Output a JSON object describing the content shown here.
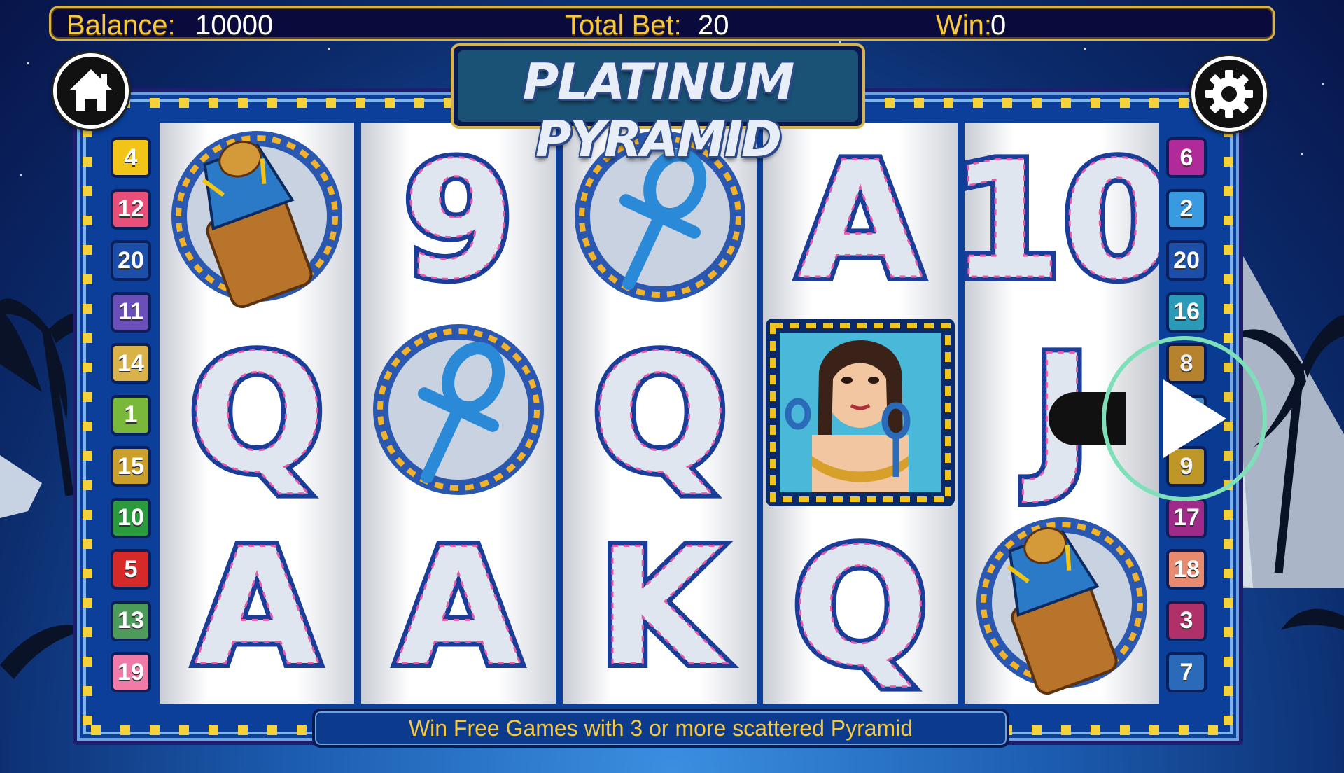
{
  "topbar": {
    "balance_label": "Balance:",
    "balance_value": "10000",
    "total_bet_label": "Total Bet:",
    "total_bet_value": "20",
    "win_label": "Win:",
    "win_value": "0"
  },
  "title": "PLATINUM PYRAMID",
  "info_message": "Win Free Games with 3 or more scattered Pyramid",
  "icons": {
    "home": "home-icon",
    "settings": "gear-icon",
    "spin": "play-icon"
  },
  "paylines_left": [
    {
      "n": "4",
      "color": "#f2c418"
    },
    {
      "n": "12",
      "color": "#e8507a"
    },
    {
      "n": "20",
      "color": "#1e4fa8"
    },
    {
      "n": "11",
      "color": "#6a4fb8"
    },
    {
      "n": "14",
      "color": "#d9b24a"
    },
    {
      "n": "1",
      "color": "#7ab83c"
    },
    {
      "n": "15",
      "color": "#caa02a"
    },
    {
      "n": "10",
      "color": "#2a9a3c"
    },
    {
      "n": "5",
      "color": "#d62a2a"
    },
    {
      "n": "13",
      "color": "#4e9a5a"
    },
    {
      "n": "19",
      "color": "#f07aa8"
    }
  ],
  "paylines_right": [
    {
      "n": "6",
      "color": "#b02a9a"
    },
    {
      "n": "2",
      "color": "#3a9ae0"
    },
    {
      "n": "20",
      "color": "#1e4fa8"
    },
    {
      "n": "16",
      "color": "#2a9ab8"
    },
    {
      "n": "8",
      "color": "#c08a30"
    },
    {
      "n": "",
      "color": "#4a90d0"
    },
    {
      "n": "9",
      "color": "#caa02a"
    },
    {
      "n": "17",
      "color": "#a02a8a"
    },
    {
      "n": "18",
      "color": "#e88a70"
    },
    {
      "n": "3",
      "color": "#b0306a"
    },
    {
      "n": "7",
      "color": "#2a6ab8"
    }
  ],
  "reels": [
    [
      "canopic-jar",
      "Q",
      "A"
    ],
    [
      "9",
      "ankh",
      "A"
    ],
    [
      "ankh",
      "Q",
      "K"
    ],
    [
      "A",
      "cleopatra",
      "Q"
    ],
    [
      "10",
      "J",
      "canopic-jar"
    ]
  ],
  "colors": {
    "gold_text": "#f6c93e",
    "frame_blue": "#0b3f9a",
    "spin_ring": "#7ee0b8"
  }
}
